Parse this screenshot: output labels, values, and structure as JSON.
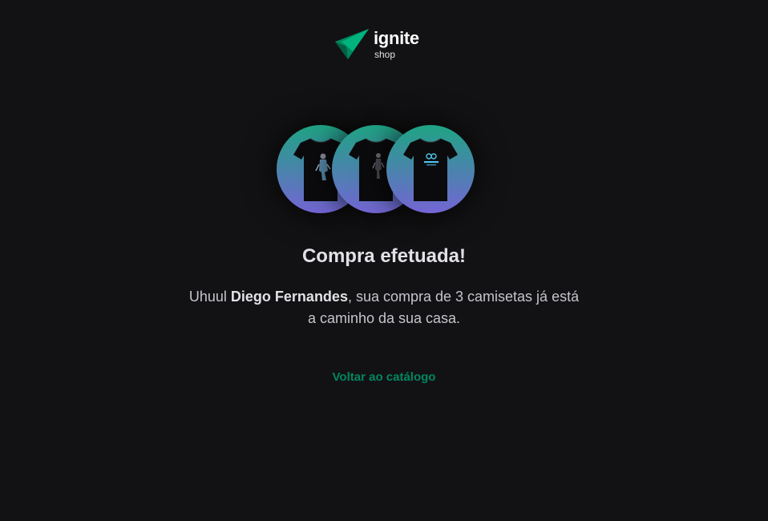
{
  "header": {
    "logo_name": "ignite",
    "logo_sub": "shop",
    "logo_colors": [
      "#00b37e",
      "#00875f",
      "#015f43"
    ]
  },
  "shirts": [
    {
      "icon": "tshirt-icon",
      "print": "figure-print"
    },
    {
      "icon": "tshirt-icon",
      "print": "figure-print"
    },
    {
      "icon": "tshirt-icon",
      "print": "ignite-logo-print"
    }
  ],
  "success": {
    "title": "Compra efetuada!",
    "message_prefix": "Uhuul ",
    "customer_name": "Diego Fernandes",
    "message_suffix": ", sua compra de 3 camisetas já está a caminho da sua casa.",
    "back_link": "Voltar ao catálogo"
  },
  "colors": {
    "background": "#121214",
    "accent": "#00875f",
    "gradient_top": "#1ea483",
    "gradient_bottom": "#7465d4"
  }
}
